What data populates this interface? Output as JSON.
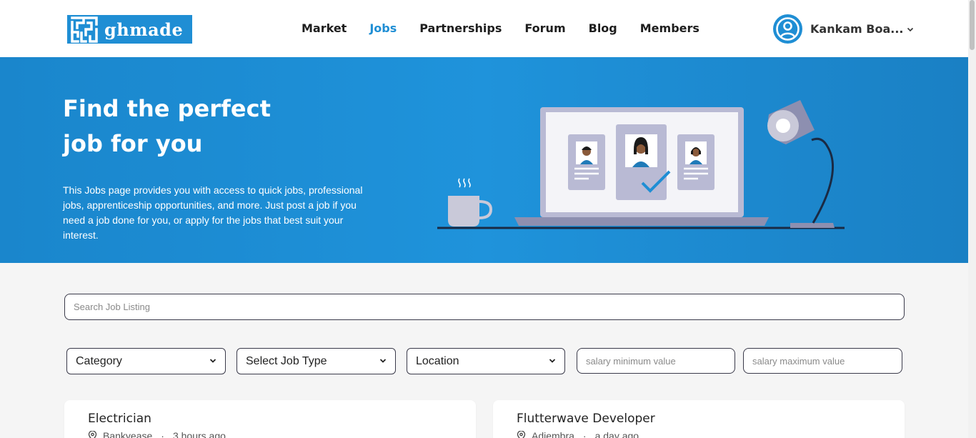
{
  "brand": {
    "name": "ghmade",
    "logo_icon": "maze-logo-icon",
    "color": "#1f8ed4"
  },
  "nav": [
    {
      "label": "Market",
      "active": false
    },
    {
      "label": "Jobs",
      "active": true
    },
    {
      "label": "Partnerships",
      "active": false
    },
    {
      "label": "Forum",
      "active": false
    },
    {
      "label": "Blog",
      "active": false
    },
    {
      "label": "Members",
      "active": false
    }
  ],
  "user": {
    "name": "Kankam Boa...",
    "avatar_icon": "user-avatar-icon",
    "menu_icon": "chevron-down-icon"
  },
  "hero": {
    "title_line1": "Find the perfect",
    "title_line2": "job for you",
    "description": "This Jobs page provides you with access to quick jobs, professional jobs, apprenticeship opportunities, and more. Just post a job if you need a job done for you, or apply for the jobs that best suit your interest."
  },
  "search": {
    "placeholder": "Search Job Listing",
    "value": ""
  },
  "filters": {
    "category": "Category",
    "job_type": "Select Job Type",
    "location": "Location",
    "salary_min_placeholder": "salary minimum value",
    "salary_max_placeholder": "salary maximum value"
  },
  "jobs": [
    {
      "title": "Electrician",
      "location": "Bankyease",
      "posted": "3 hours ago"
    },
    {
      "title": "Flutterwave Developer",
      "location": "Adiembra",
      "posted": "a day ago"
    }
  ]
}
